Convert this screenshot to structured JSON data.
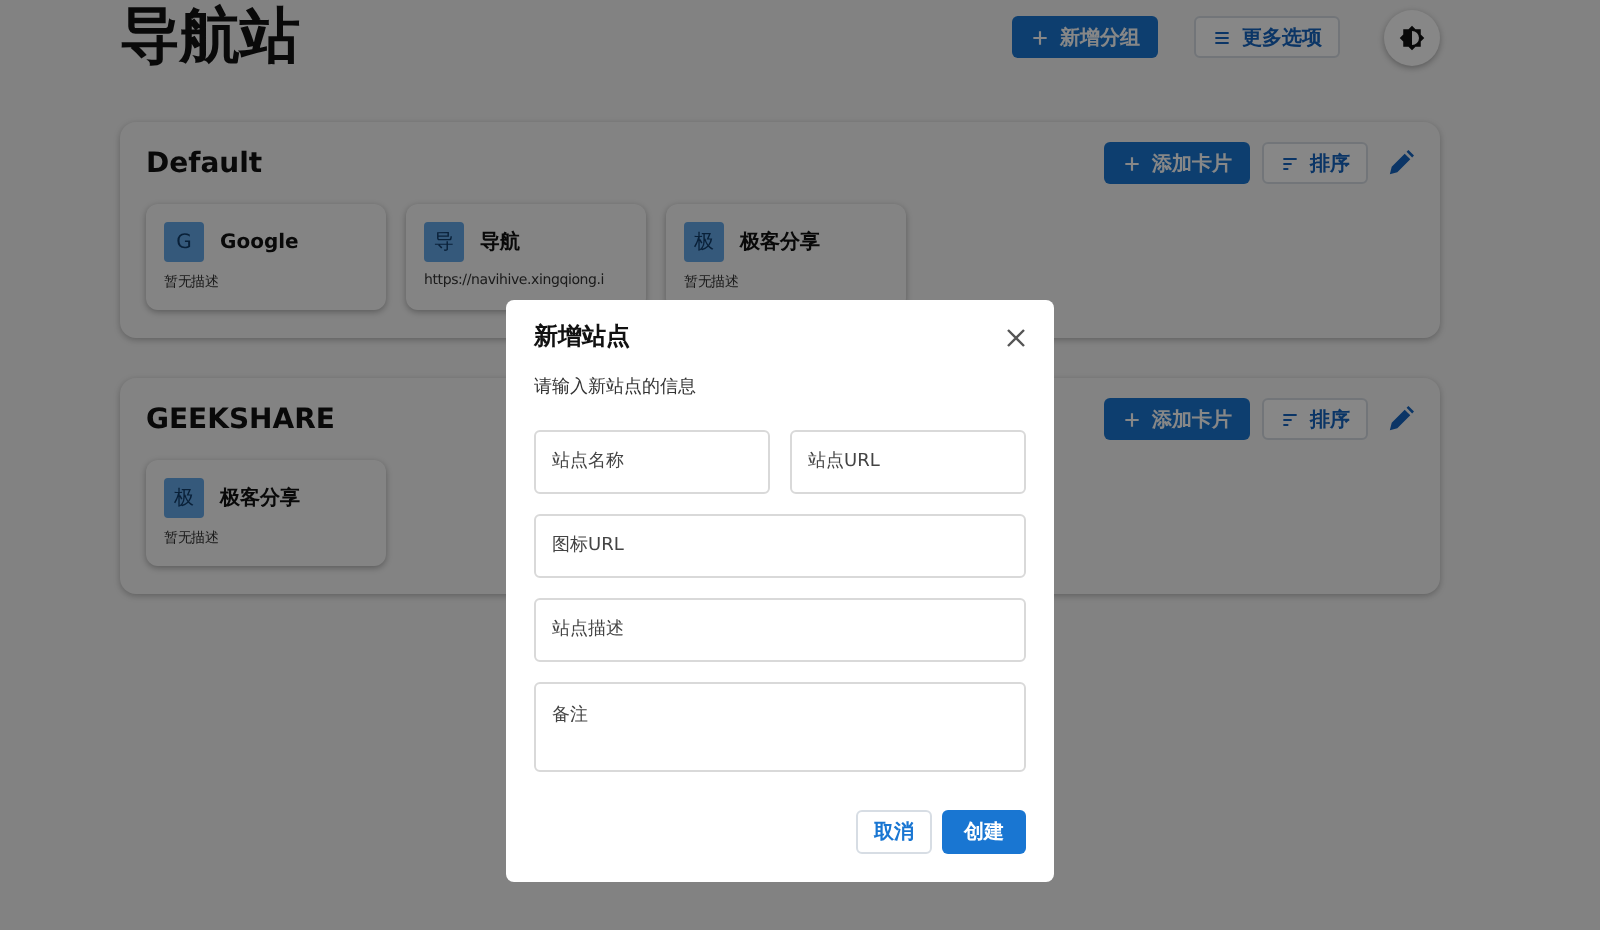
{
  "header": {
    "title": "导航站",
    "add_group_button": "新增分组",
    "more_button": "更多选项"
  },
  "groups": [
    {
      "name": "Default",
      "add_card_button": "添加卡片",
      "sort_button": "排序",
      "cards": [
        {
          "icon_letter": "G",
          "name": "Google",
          "description": "暂无描述"
        },
        {
          "icon_letter": "导",
          "name": "导航",
          "description": "https://navihive.xingqiong.i"
        },
        {
          "icon_letter": "极",
          "name": "极客分享",
          "description": "暂无描述"
        }
      ]
    },
    {
      "name": "GEEKSHARE",
      "add_card_button": "添加卡片",
      "sort_button": "排序",
      "cards": [
        {
          "icon_letter": "极",
          "name": "极客分享",
          "description": "暂无描述"
        }
      ]
    }
  ],
  "dialog": {
    "title": "新增站点",
    "subtitle": "请输入新站点的信息",
    "fields": [
      {
        "placeholder": "站点名称",
        "kind": "half"
      },
      {
        "placeholder": "站点URL",
        "kind": "half"
      },
      {
        "placeholder": "图标URL",
        "kind": "full"
      },
      {
        "placeholder": "站点描述",
        "kind": "full"
      },
      {
        "placeholder": "备注",
        "kind": "multiline"
      }
    ],
    "cancel_button": "取消",
    "create_button": "创建"
  }
}
